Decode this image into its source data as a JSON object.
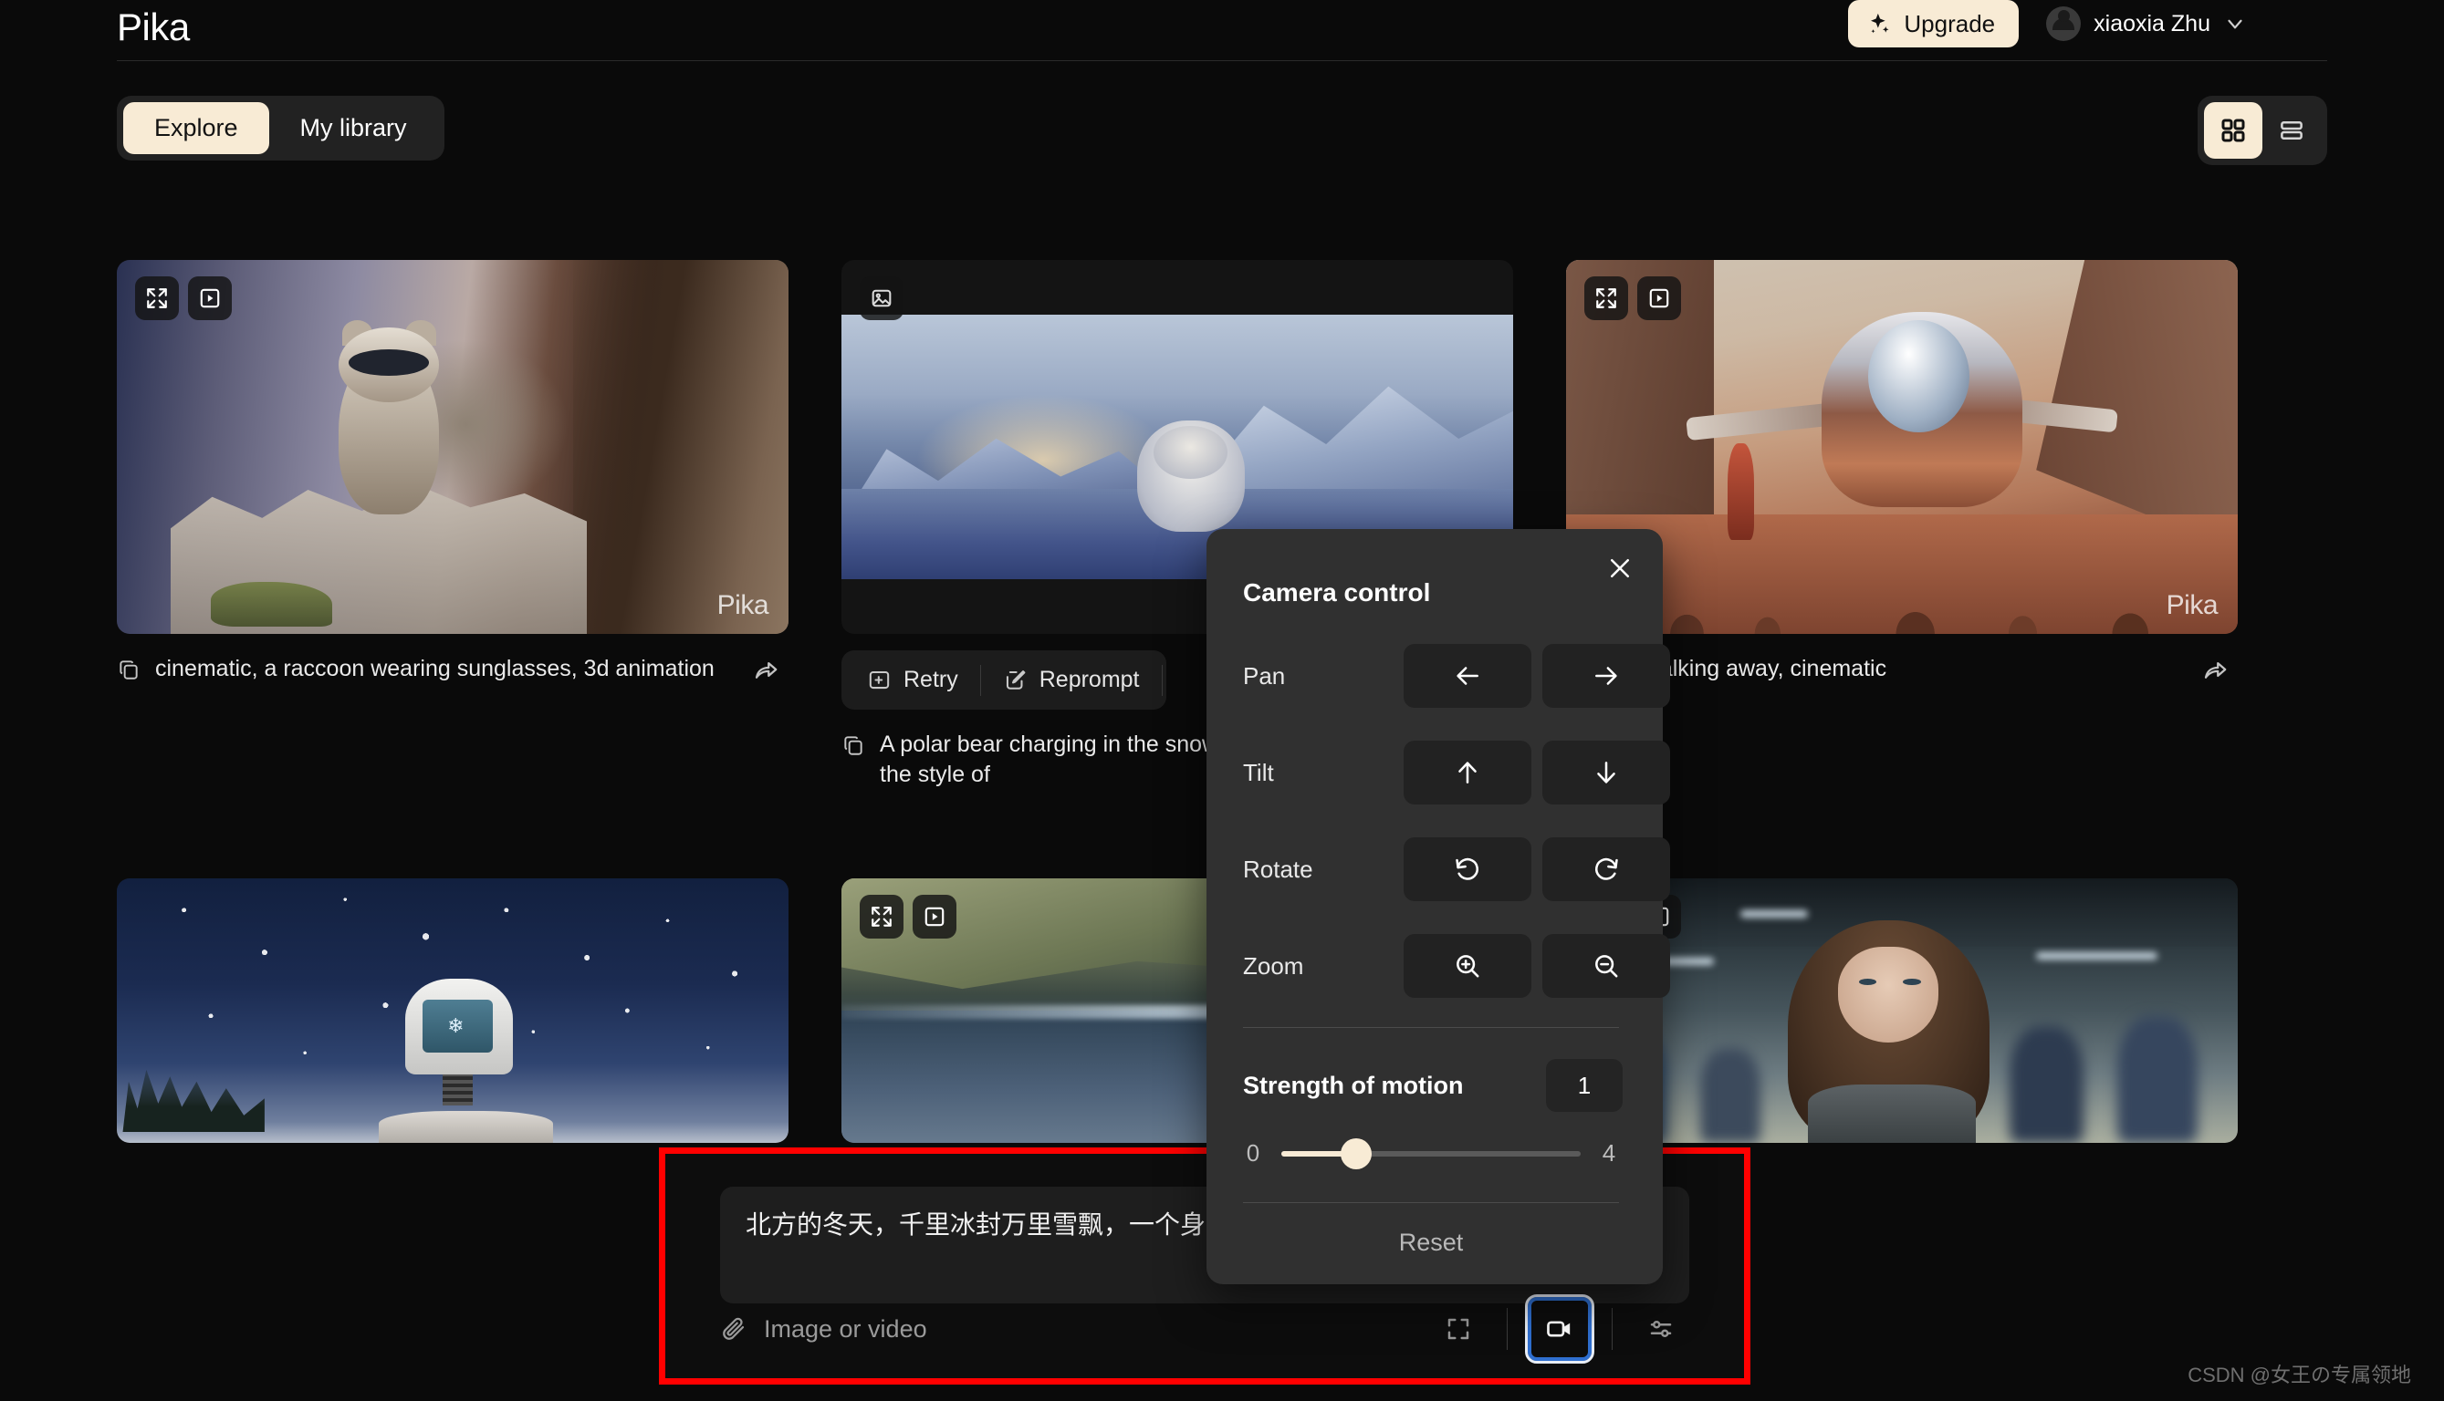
{
  "brand": {
    "logo": "Pika"
  },
  "header": {
    "upgrade_label": "Upgrade",
    "user_name": "xiaoxia Zhu",
    "sparkle_icon": "sparkle-icon",
    "avatar_icon": "avatar",
    "chevron_icon": "chevron-down-icon"
  },
  "tabs": {
    "items": [
      {
        "label": "Explore",
        "active": true
      },
      {
        "label": "My library",
        "active": false
      }
    ]
  },
  "view_toggle": {
    "grid_label": "grid-view",
    "list_label": "list-view",
    "active": "grid"
  },
  "gallery": {
    "cards": [
      {
        "caption": "cinematic, a raccoon wearing sunglasses, 3d animation",
        "watermark": "Pika",
        "overlay_icons": [
          "expand-icon",
          "play-icon"
        ]
      },
      {
        "caption": "A polar bear charging in the snow rapidly, growling, in the style of",
        "overlay_icons": [
          "image-icon"
        ],
        "actions": [
          {
            "label": "Retry",
            "icon": "retry-icon"
          },
          {
            "label": "Reprompt",
            "icon": "edit-icon"
          }
        ]
      },
      {
        "caption": "tronaut walking away, cinematic",
        "watermark": "Pika",
        "overlay_icons": [
          "expand-icon",
          "play-icon"
        ]
      },
      {
        "caption": "",
        "overlay_icons": []
      },
      {
        "caption": "",
        "overlay_icons": [
          "expand-icon",
          "play-icon"
        ]
      },
      {
        "caption": "",
        "overlay_icons": [
          "expand-icon",
          "play-icon"
        ]
      }
    ]
  },
  "camera_control": {
    "title": "Camera control",
    "close_icon": "close-icon",
    "rows": [
      {
        "label": "Pan",
        "left_icon": "arrow-left-icon",
        "right_icon": "arrow-right-icon"
      },
      {
        "label": "Tilt",
        "left_icon": "arrow-up-icon",
        "right_icon": "arrow-down-icon"
      },
      {
        "label": "Rotate",
        "left_icon": "rotate-ccw-icon",
        "right_icon": "rotate-cw-icon"
      },
      {
        "label": "Zoom",
        "left_icon": "zoom-in-icon",
        "right_icon": "zoom-out-icon"
      }
    ],
    "strength": {
      "label": "Strength of motion",
      "value": "1",
      "min": "0",
      "max": "4",
      "percent": 25
    },
    "reset_label": "Reset",
    "accent_color": "#f8ebd5",
    "panel_color": "#303030"
  },
  "prompt_bar": {
    "value": "北方的冬天，千里冰封万里雪飘，一个身在雪中舞剑。",
    "attach_label": "Image or video",
    "attach_icon": "paperclip-icon",
    "tools": [
      {
        "icon": "aspect-ratio-icon",
        "focused": false
      },
      {
        "icon": "video-camera-icon",
        "focused": true
      },
      {
        "icon": "settings-sliders-icon",
        "focused": false
      }
    ],
    "highlight_color": "#ff0000",
    "focus_color": "#2f6fd0"
  },
  "watermark": "CSDN @女王の专属领地"
}
